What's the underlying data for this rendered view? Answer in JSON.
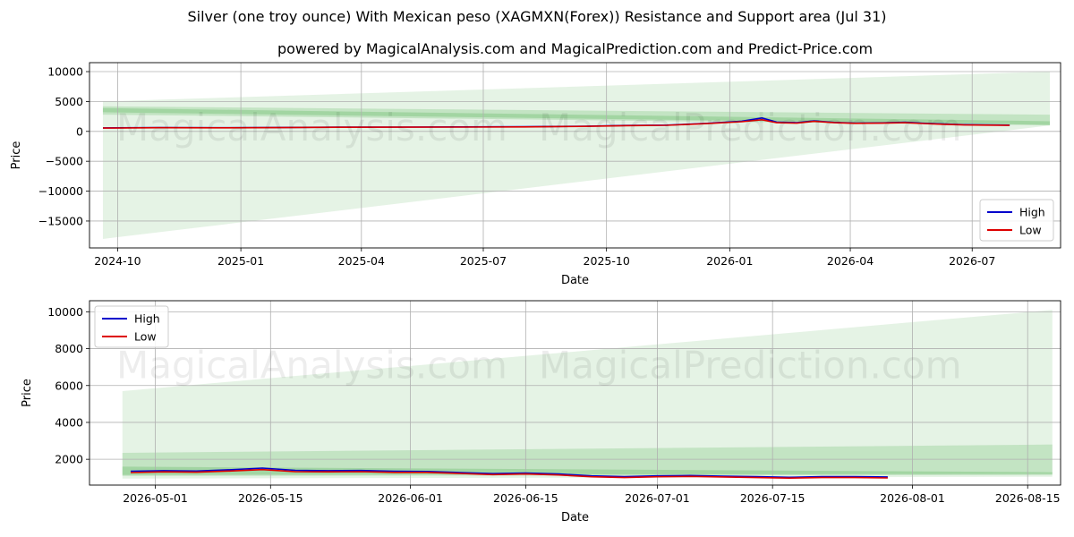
{
  "title": "Silver (one troy ounce) With Mexican peso (XAGMXN(Forex)) Resistance and Support area (Jul 31)",
  "subtitle": "powered by MagicalAnalysis.com and MagicalPrediction.com and Predict-Price.com",
  "watermarks": [
    "MagicalAnalysis.com",
    "MagicalPrediction.com"
  ],
  "colors": {
    "high": "#0000cc",
    "low": "#dd0000",
    "band": "#2ca02c",
    "grid": "#b0b0b0"
  },
  "chart_data": [
    {
      "type": "line",
      "panel": "top",
      "xlabel": "Date",
      "ylabel": "Price",
      "grid": true,
      "legend_placement": "lower-right",
      "xlim": [
        "2024-09-10",
        "2026-09-05"
      ],
      "ylim": [
        -19500,
        11500
      ],
      "x_ticks": [
        "2024-10",
        "2025-01",
        "2025-04",
        "2025-07",
        "2025-10",
        "2026-01",
        "2026-04",
        "2026-07"
      ],
      "y_ticks": [
        10000,
        5000,
        0,
        -5000,
        -10000,
        -15000
      ],
      "series": [
        {
          "name": "High",
          "color": "#0000cc",
          "x": [
            "2024-09-20",
            "2024-11-01",
            "2024-12-15",
            "2025-02-01",
            "2025-03-15",
            "2025-05-01",
            "2025-06-15",
            "2025-08-01",
            "2025-09-15",
            "2025-10-15",
            "2025-11-15",
            "2025-12-15",
            "2026-01-10",
            "2026-01-25",
            "2026-02-05",
            "2026-02-20",
            "2026-03-05",
            "2026-03-20",
            "2026-04-05",
            "2026-04-25",
            "2026-05-12",
            "2026-05-25",
            "2026-06-10",
            "2026-06-25",
            "2026-07-10",
            "2026-07-29"
          ],
          "values": [
            580,
            640,
            620,
            650,
            700,
            720,
            740,
            770,
            860,
            980,
            1050,
            1350,
            1700,
            2250,
            1550,
            1450,
            1750,
            1500,
            1380,
            1420,
            1520,
            1360,
            1220,
            1120,
            1080,
            1040
          ]
        },
        {
          "name": "Low",
          "color": "#dd0000",
          "x": [
            "2024-09-20",
            "2024-11-01",
            "2024-12-15",
            "2025-02-01",
            "2025-03-15",
            "2025-05-01",
            "2025-06-15",
            "2025-08-01",
            "2025-09-15",
            "2025-10-15",
            "2025-11-15",
            "2025-12-15",
            "2026-01-10",
            "2026-01-25",
            "2026-02-05",
            "2026-02-20",
            "2026-03-05",
            "2026-03-20",
            "2026-04-05",
            "2026-04-25",
            "2026-05-12",
            "2026-05-25",
            "2026-06-10",
            "2026-06-25",
            "2026-07-10",
            "2026-07-29"
          ],
          "values": [
            560,
            620,
            600,
            630,
            680,
            700,
            720,
            750,
            840,
            950,
            1020,
            1300,
            1620,
            1950,
            1450,
            1380,
            1680,
            1450,
            1340,
            1380,
            1450,
            1320,
            1180,
            1080,
            1040,
            1000
          ]
        }
      ],
      "bands": [
        {
          "x": [
            "2024-09-20",
            "2026-08-28"
          ],
          "upper": [
            5000,
            10000
          ],
          "lower": [
            -18000,
            1000
          ],
          "opacity": 0.12
        },
        {
          "x": [
            "2024-09-20",
            "2026-08-28"
          ],
          "upper": [
            4200,
            2800
          ],
          "lower": [
            2800,
            1000
          ],
          "opacity": 0.18
        },
        {
          "x": [
            "2024-09-20",
            "2026-08-28"
          ],
          "upper": [
            3900,
            1700
          ],
          "lower": [
            3200,
            1100
          ],
          "opacity": 0.22
        }
      ]
    },
    {
      "type": "line",
      "panel": "bottom",
      "xlabel": "Date",
      "ylabel": "Price",
      "grid": true,
      "legend_placement": "upper-left",
      "xlim": [
        "2026-04-23",
        "2026-08-19"
      ],
      "ylim": [
        600,
        10600
      ],
      "x_ticks": [
        "2026-05-01",
        "2026-05-15",
        "2026-06-01",
        "2026-06-15",
        "2026-07-01",
        "2026-07-15",
        "2026-08-01",
        "2026-08-15"
      ],
      "y_ticks": [
        10000,
        8000,
        6000,
        4000,
        2000
      ],
      "series": [
        {
          "name": "High",
          "color": "#0000cc",
          "x": [
            "2026-04-28",
            "2026-05-02",
            "2026-05-06",
            "2026-05-10",
            "2026-05-14",
            "2026-05-18",
            "2026-05-22",
            "2026-05-26",
            "2026-05-30",
            "2026-06-03",
            "2026-06-07",
            "2026-06-11",
            "2026-06-15",
            "2026-06-19",
            "2026-06-23",
            "2026-06-27",
            "2026-07-01",
            "2026-07-05",
            "2026-07-09",
            "2026-07-13",
            "2026-07-17",
            "2026-07-21",
            "2026-07-25",
            "2026-07-29"
          ],
          "values": [
            1350,
            1380,
            1360,
            1430,
            1520,
            1400,
            1380,
            1390,
            1350,
            1340,
            1280,
            1220,
            1250,
            1200,
            1100,
            1060,
            1100,
            1120,
            1080,
            1060,
            1020,
            1060,
            1060,
            1040
          ]
        },
        {
          "name": "Low",
          "color": "#dd0000",
          "x": [
            "2026-04-28",
            "2026-05-02",
            "2026-05-06",
            "2026-05-10",
            "2026-05-14",
            "2026-05-18",
            "2026-05-22",
            "2026-05-26",
            "2026-05-30",
            "2026-06-03",
            "2026-06-07",
            "2026-06-11",
            "2026-06-15",
            "2026-06-19",
            "2026-06-23",
            "2026-06-27",
            "2026-07-01",
            "2026-07-05",
            "2026-07-09",
            "2026-07-13",
            "2026-07-17",
            "2026-07-21",
            "2026-07-25",
            "2026-07-29"
          ],
          "values": [
            1280,
            1320,
            1300,
            1360,
            1440,
            1330,
            1320,
            1330,
            1290,
            1290,
            1230,
            1170,
            1200,
            1150,
            1050,
            1010,
            1050,
            1070,
            1040,
            1010,
            980,
            1010,
            1010,
            990
          ]
        }
      ],
      "bands": [
        {
          "x": [
            "2026-04-27",
            "2026-08-18"
          ],
          "upper": [
            5700,
            10100
          ],
          "lower": [
            950,
            1050
          ],
          "opacity": 0.12
        },
        {
          "x": [
            "2026-04-27",
            "2026-08-18"
          ],
          "upper": [
            2350,
            2800
          ],
          "lower": [
            1100,
            1150
          ],
          "opacity": 0.18
        },
        {
          "x": [
            "2026-04-27",
            "2026-08-18"
          ],
          "upper": [
            1600,
            1300
          ],
          "lower": [
            1150,
            1200
          ],
          "opacity": 0.22
        }
      ]
    }
  ]
}
